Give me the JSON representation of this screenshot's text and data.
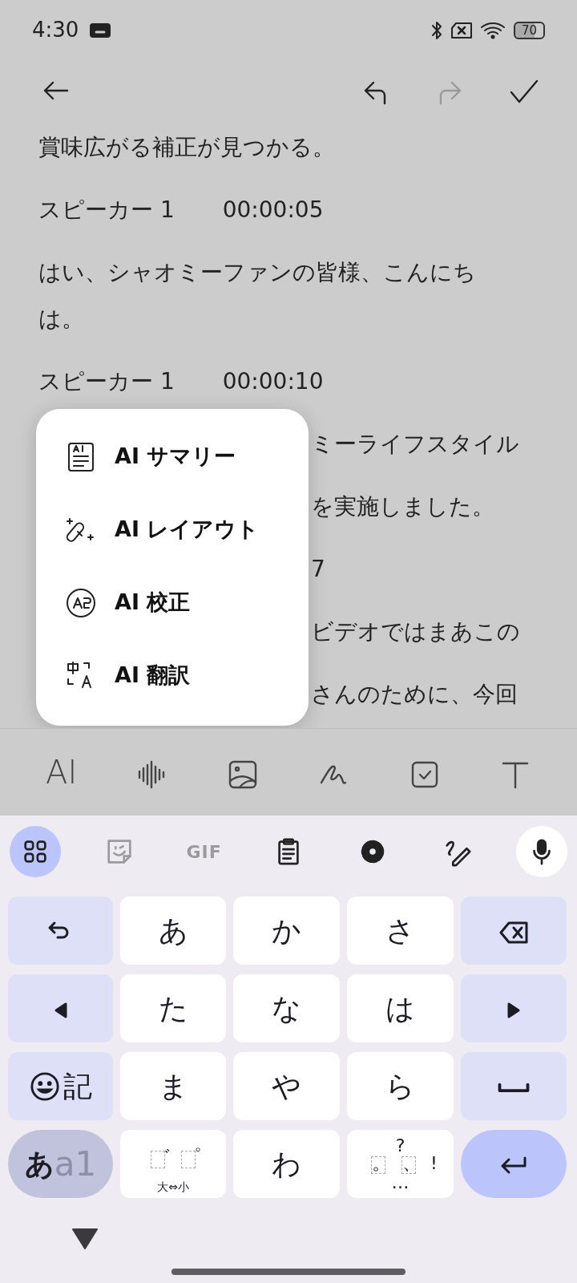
{
  "status_bar": {
    "time": "4:30",
    "battery": "70"
  },
  "toolbar": [
    {
      "kind": "back",
      "disabled": false
    },
    {
      "kind": "undo",
      "disabled": false
    },
    {
      "kind": "redo",
      "disabled": true
    },
    {
      "kind": "done",
      "disabled": false
    }
  ],
  "document": [
    {
      "kind": "text",
      "text": "賞味広がる補正が見つかる。"
    },
    {
      "kind": "speaker",
      "speaker": "スピーカー 1",
      "time": "00:00:05"
    },
    {
      "kind": "text",
      "text": "はい、シャオミーファンの皆様、こんにちは。"
    },
    {
      "kind": "speaker",
      "speaker": "スピーカー 1",
      "time": "00:00:10"
    },
    {
      "kind": "fragment",
      "text": "ミーライフスタイル"
    },
    {
      "kind": "fragment",
      "text": "を実施しました。"
    },
    {
      "kind": "fragment",
      "text": "7"
    },
    {
      "kind": "fragment",
      "text": "ビデオではまあこの"
    },
    {
      "kind": "fragment",
      "text": "さんのために、今回"
    }
  ],
  "ai_menu": [
    {
      "kind": "summary",
      "label": "AI サマリー"
    },
    {
      "kind": "layout",
      "label": "AI レイアウト"
    },
    {
      "kind": "proofread",
      "label": "AI 校正"
    },
    {
      "kind": "translate",
      "label": "AI 翻訳"
    }
  ],
  "format_bar": [
    {
      "kind": "text",
      "text": "AI"
    },
    {
      "kind": "audio"
    },
    {
      "kind": "image"
    },
    {
      "kind": "draw"
    },
    {
      "kind": "checklist"
    },
    {
      "kind": "textstyle"
    }
  ],
  "keyboard_toolbar": [
    {
      "kind": "apps",
      "selected": true,
      "disabled": false
    },
    {
      "kind": "sticker",
      "selected": false,
      "disabled": true
    },
    {
      "kind": "gif",
      "text": "GIF",
      "selected": false,
      "disabled": true
    },
    {
      "kind": "clipboard",
      "selected": false,
      "disabled": false
    },
    {
      "kind": "settings",
      "selected": false,
      "disabled": false
    },
    {
      "kind": "handwriting",
      "selected": false,
      "disabled": false
    },
    {
      "kind": "mic",
      "selected": false,
      "disabled": false
    }
  ],
  "keys": [
    {
      "kind": "undo"
    },
    {
      "kind": "char",
      "label": "あ"
    },
    {
      "kind": "char",
      "label": "か"
    },
    {
      "kind": "char",
      "label": "さ"
    },
    {
      "kind": "backspace"
    },
    {
      "kind": "left"
    },
    {
      "kind": "char",
      "label": "た"
    },
    {
      "kind": "char",
      "label": "な"
    },
    {
      "kind": "char",
      "label": "は"
    },
    {
      "kind": "right"
    },
    {
      "kind": "symbol",
      "label": "記"
    },
    {
      "kind": "char",
      "label": "ま"
    },
    {
      "kind": "char",
      "label": "や"
    },
    {
      "kind": "char",
      "label": "ら"
    },
    {
      "kind": "space"
    },
    {
      "kind": "mode",
      "label": "あ",
      "alt": "a1"
    },
    {
      "kind": "dakuten",
      "marks": [
        "゛",
        "゜"
      ],
      "sub": "大⇔小"
    },
    {
      "kind": "char",
      "label": "わ"
    },
    {
      "kind": "punct",
      "top": "?",
      "marks": [
        "。",
        "、"
      ],
      "side": "!",
      "bottom": "…"
    },
    {
      "kind": "enter"
    }
  ]
}
